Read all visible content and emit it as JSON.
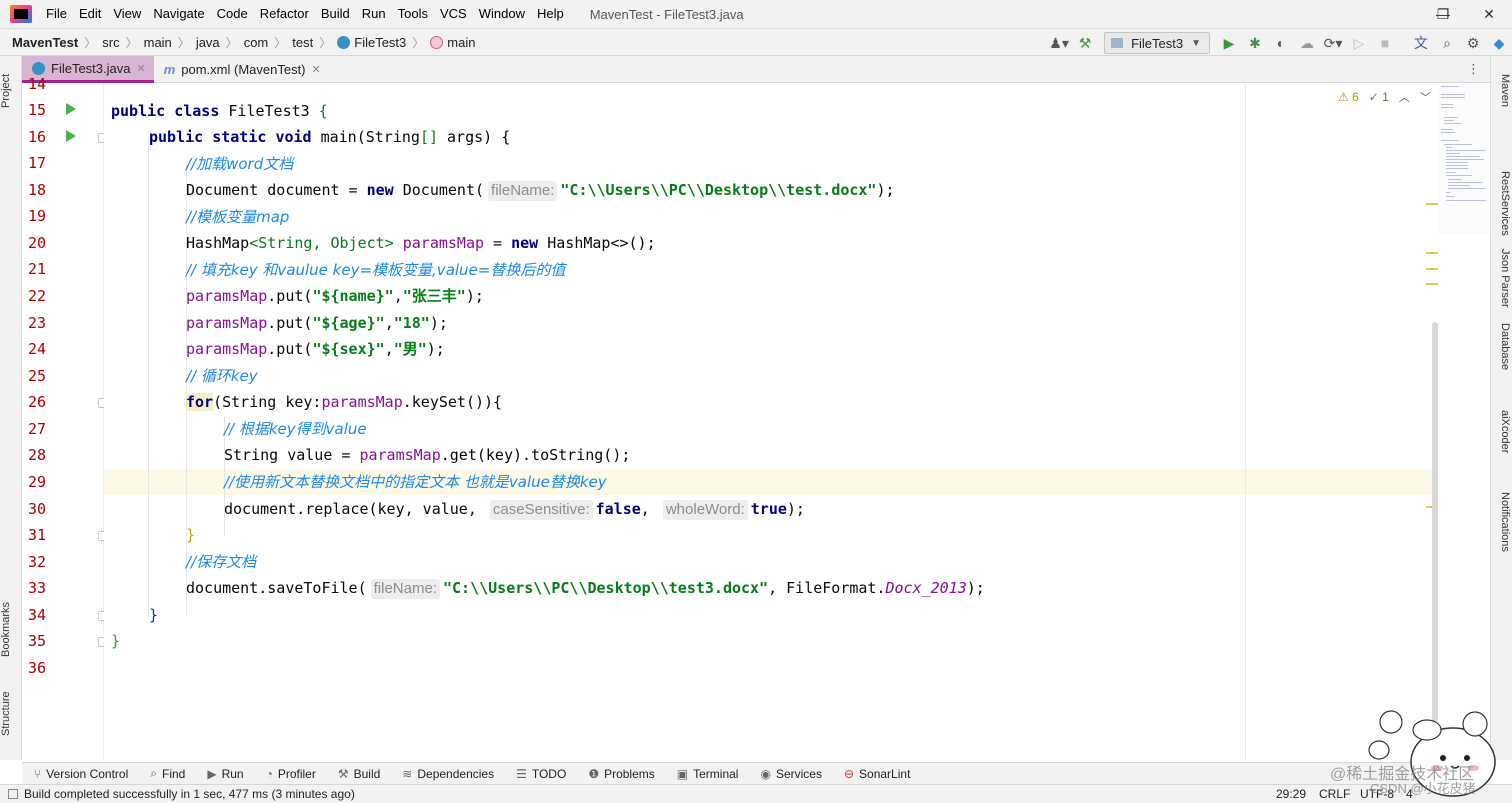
{
  "window": {
    "title": "MavenTest - FileTest3.java",
    "menu": [
      "File",
      "Edit",
      "View",
      "Navigate",
      "Code",
      "Refactor",
      "Build",
      "Run",
      "Tools",
      "VCS",
      "Window",
      "Help"
    ],
    "controls": {
      "minimize": "—",
      "maximize": "❐",
      "close": "✕"
    }
  },
  "breadcrumb": [
    "MavenTest",
    "src",
    "main",
    "java",
    "com",
    "test",
    "FileTest3",
    "main"
  ],
  "toolbar": {
    "run_config": "FileTest3",
    "icons": [
      "user-icon",
      "hammer-icon",
      "run-icon",
      "debug-icon",
      "coverage-icon",
      "profile-icon",
      "more-run-icon",
      "step-icon",
      "stop-icon",
      "translate-icon",
      "search-icon",
      "settings-icon",
      "plugin-icon"
    ]
  },
  "left_tools": {
    "project": "Project",
    "bookmarks": "Bookmarks",
    "structure": "Structure"
  },
  "right_tools": [
    "Maven",
    "RestServices",
    "Json Parser",
    "Database",
    "aiXcoder",
    "Notifications"
  ],
  "tabs": [
    {
      "label": "FileTest3.java",
      "active": true
    },
    {
      "label": "pom.xml (MavenTest)",
      "active": false
    }
  ],
  "editor": {
    "first_partial_line": "14",
    "line_numbers": [
      "15",
      "16",
      "17",
      "18",
      "19",
      "20",
      "21",
      "22",
      "23",
      "24",
      "25",
      "26",
      "27",
      "28",
      "29",
      "30",
      "31",
      "32",
      "33",
      "34",
      "35",
      "36"
    ],
    "caret_line": "29",
    "inspection": {
      "warnings": "6",
      "weak_warnings": "1"
    },
    "code": {
      "l15": {
        "kw1": "public",
        "kw2": "class",
        "name": "FileTest3",
        "brace": "{"
      },
      "l16": {
        "kw1": "public",
        "kw2": "static",
        "kw3": "void",
        "rest": "main(String",
        "brackets": "[]",
        "args": "args) {"
      },
      "l17": {
        "comment": "//加载word文档"
      },
      "l18": {
        "pre": "Document document = ",
        "kw": "new",
        "call": "Document(",
        "hint": "fileName:",
        "str": "\"C:\\\\Users\\\\PC\\\\Desktop\\\\test.docx\"",
        "end": ");"
      },
      "l19": {
        "comment": "//模板变量map"
      },
      "l20": {
        "type": "HashMap",
        "generic": "<String, Object>",
        "field": "paramsMap",
        "mid": " = ",
        "kw": "new",
        "end": "HashMap<>();"
      },
      "l21": {
        "comment": "// 填充key 和vaulue key=模板变量,value=替换后的值"
      },
      "l22": {
        "field": "paramsMap",
        "call": ".put(",
        "s1": "\"${name}\"",
        "comma": ",",
        "s2": "\"张三丰\"",
        "end": ");"
      },
      "l23": {
        "field": "paramsMap",
        "call": ".put(",
        "s1": "\"${age}\"",
        "comma": ",",
        "s2": "\"18\"",
        "end": ");"
      },
      "l24": {
        "field": "paramsMap",
        "call": ".put(",
        "s1": "\"${sex}\"",
        "comma": ",",
        "s2": "\"男\"",
        "end": ");"
      },
      "l25": {
        "comment": "// 循环key"
      },
      "l26": {
        "kw": "for",
        "pre": "(String key:",
        "field": "paramsMap",
        "end": ".keySet()){"
      },
      "l27": {
        "comment": "// 根据key得到value"
      },
      "l28": {
        "pre": "String value = ",
        "field": "paramsMap",
        "end": ".get(key).toString();"
      },
      "l29": {
        "comment": "//使用新文本替换文档中的指定文本 也就是value替换key"
      },
      "l30": {
        "pre": "document.replace(key, value, ",
        "hint1": "caseSensitive:",
        "kw1": "false",
        "comma": ", ",
        "hint2": "wholeWord:",
        "kw2": "true",
        "end": ");"
      },
      "l31": {
        "brace": "}"
      },
      "l32": {
        "comment": "//保存文档"
      },
      "l33": {
        "pre": "document.saveToFile(",
        "hint": "fileName:",
        "str": "\"C:\\\\Users\\\\PC\\\\Desktop\\\\test3.docx\"",
        "mid": ", FileFormat.",
        "const": "Docx_2013",
        "end": ");"
      },
      "l34": {
        "brace": "}"
      },
      "l35": {
        "brace": "}"
      }
    }
  },
  "bottom_tools": [
    {
      "label": "Version Control",
      "icon": "branch-icon"
    },
    {
      "label": "Find",
      "icon": "search-icon"
    },
    {
      "label": "Run",
      "icon": "run-icon"
    },
    {
      "label": "Profiler",
      "icon": "profiler-icon"
    },
    {
      "label": "Build",
      "icon": "hammer-icon"
    },
    {
      "label": "Dependencies",
      "icon": "layers-icon"
    },
    {
      "label": "TODO",
      "icon": "list-icon"
    },
    {
      "label": "Problems",
      "icon": "problems-icon"
    },
    {
      "label": "Terminal",
      "icon": "terminal-icon"
    },
    {
      "label": "Services",
      "icon": "services-icon"
    },
    {
      "label": "SonarLint",
      "icon": "sonarlint-icon"
    }
  ],
  "status": {
    "message": "Build completed successfully in 1 sec, 477 ms (3 minutes ago)",
    "position": "29:29",
    "line_sep": "CRLF",
    "encoding": "UTF-8",
    "indent": "4"
  },
  "watermark": {
    "line1": "@稀土掘金技术社区",
    "line2": "CSDN @小花皮猪"
  },
  "colors": {
    "accent_tab": "#d9b5d4",
    "keyword": "#000080",
    "string": "#067d17",
    "field": "#871094",
    "comment": "#1e88e5",
    "line_number": "#b00000"
  }
}
